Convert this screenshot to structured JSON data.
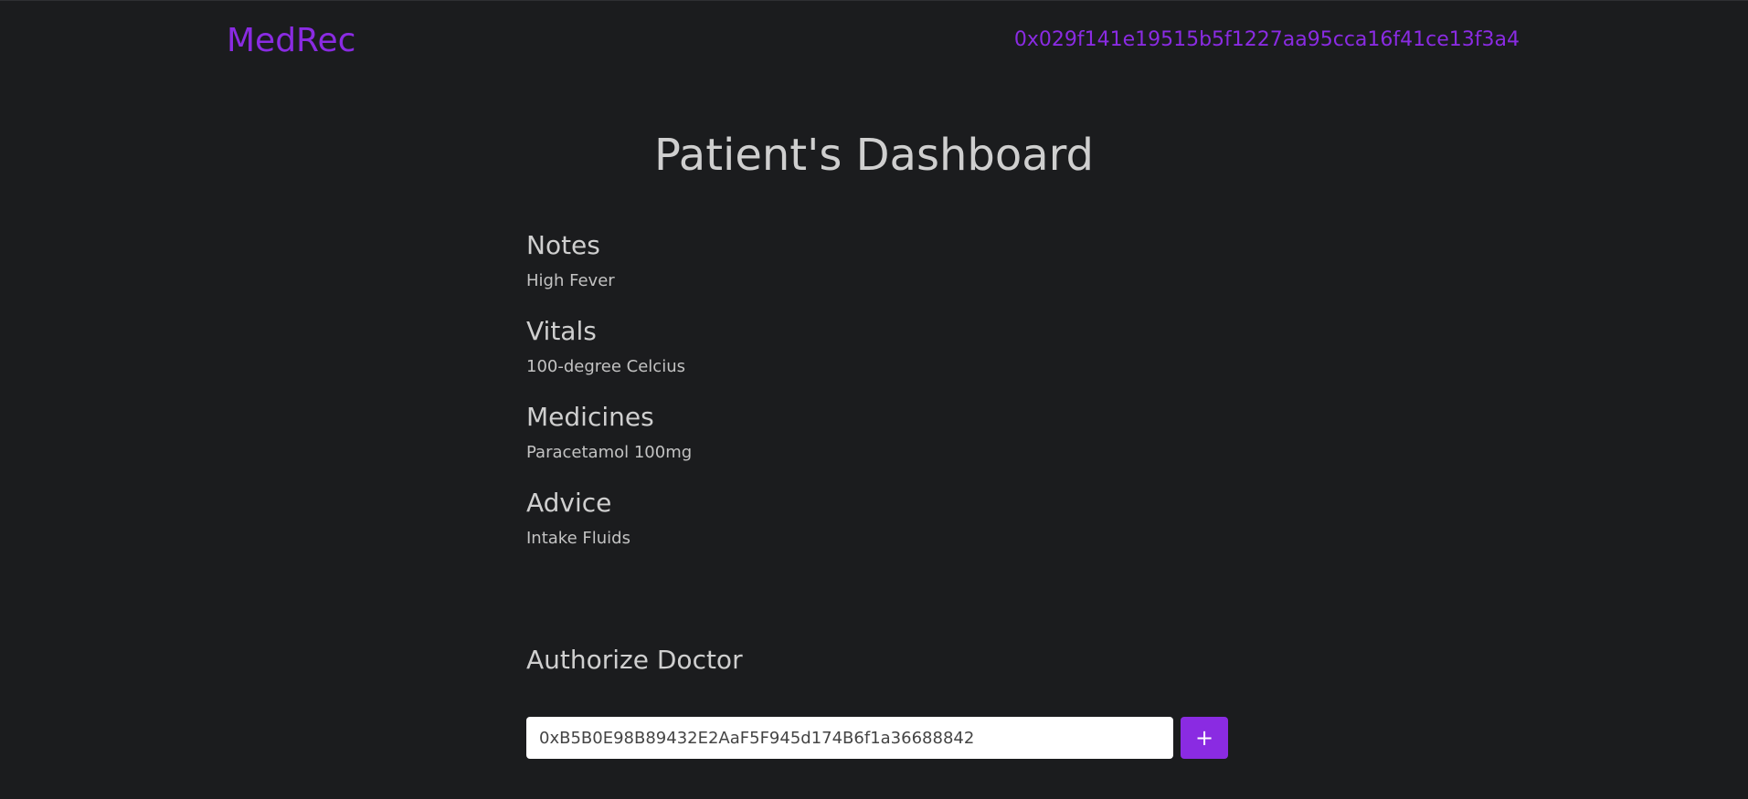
{
  "header": {
    "brand": "MedRec",
    "account_address": "0x029f141e19515b5f1227aa95cca16f41ce13f3a4"
  },
  "page_title": "Patient's Dashboard",
  "records": [
    {
      "heading": "Notes",
      "value": "High Fever"
    },
    {
      "heading": "Vitals",
      "value": "100-degree Celcius"
    },
    {
      "heading": "Medicines",
      "value": "Paracetamol 100mg"
    },
    {
      "heading": "Advice",
      "value": "Intake Fluids"
    }
  ],
  "authorize": {
    "title": "Authorize Doctor",
    "input_value": "0xB5B0E98B89432E2AaF5F945d174B6f1a36688842",
    "button_label": "+"
  },
  "colors": {
    "background": "#1b1c1e",
    "accent": "#8a2be2",
    "text": "#c9c9c9"
  }
}
